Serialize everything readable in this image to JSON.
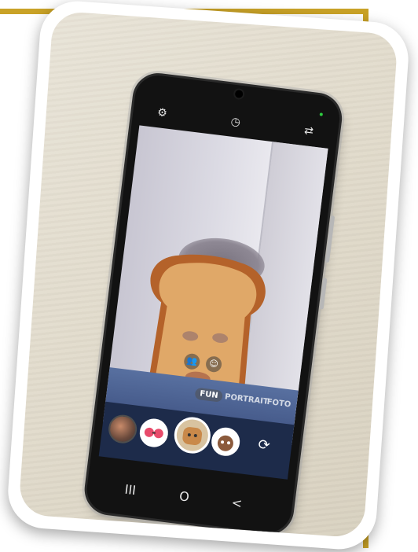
{
  "camera_app": {
    "top_icons": [
      "settings-icon",
      "timer-icon",
      "switch-camera-icon"
    ],
    "modes": {
      "fun": "FUN",
      "portrait": "PORTRAIT",
      "foto": "FOTO"
    },
    "selected_mode": "FUN",
    "effect": "toast-face-lens",
    "face_chips": [
      "group-faces-icon",
      "single-face-icon"
    ],
    "lens_tray": [
      "gallery-thumbnail",
      "glasses-lens",
      "bread-lens",
      "dog-lens"
    ],
    "nav_buttons": {
      "recents": "III",
      "home": "O",
      "back": "<"
    }
  },
  "colors": {
    "frame_gold": "#c9a227",
    "camera_bottom_panel": "#1d2b4a",
    "toast_crust": "#b4622a"
  }
}
